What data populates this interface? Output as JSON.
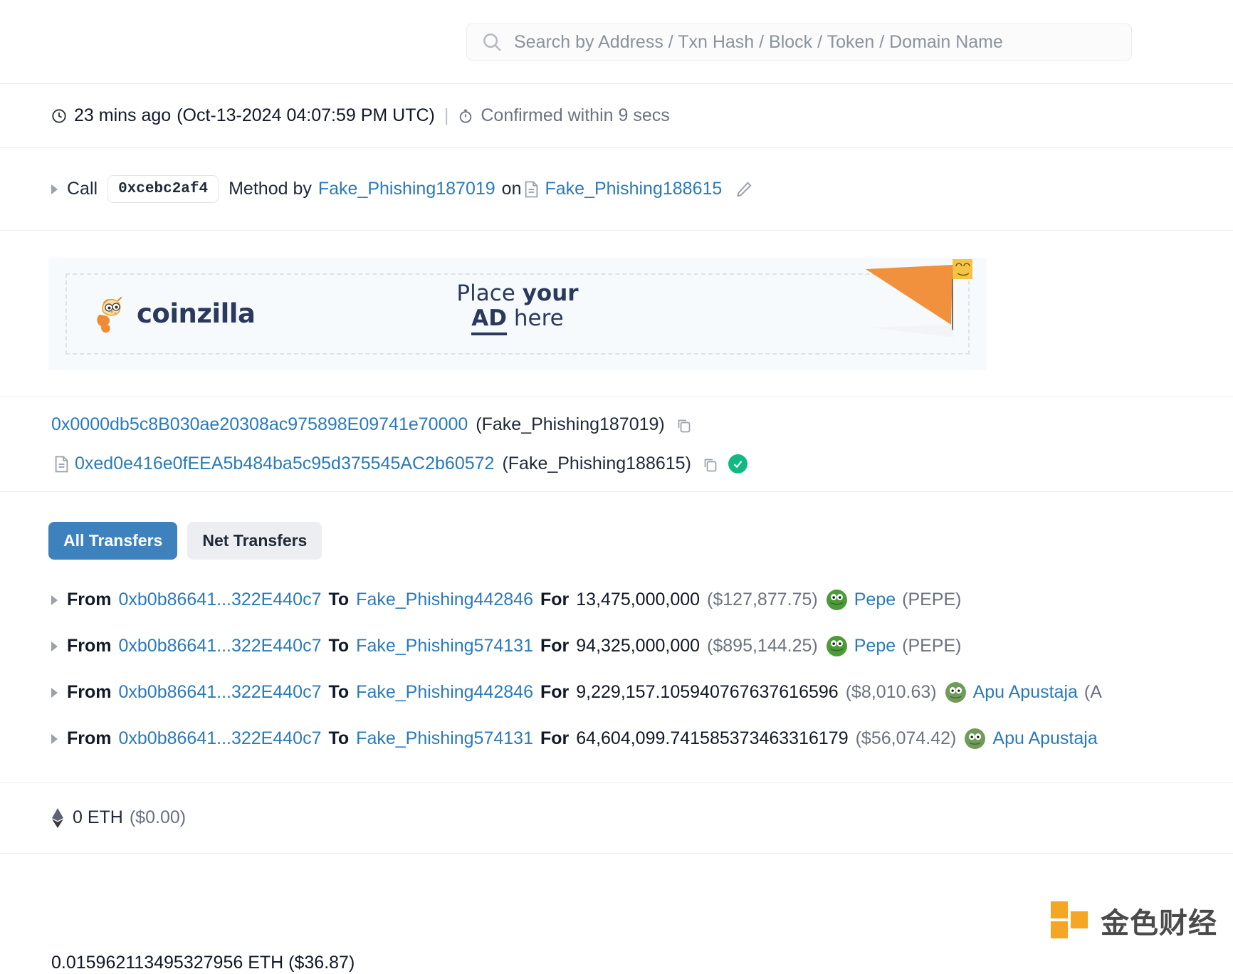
{
  "search": {
    "placeholder": "Search by Address / Txn Hash / Block / Token / Domain Name",
    "icon": "search-icon"
  },
  "timestamp": {
    "relative": "23 mins ago",
    "absolute": "(Oct-13-2024 04:07:59 PM UTC)",
    "separator": "|",
    "confirmation": "Confirmed within 9 secs",
    "clock_icon": "clock-icon",
    "timer_icon": "timer-icon"
  },
  "method": {
    "call_label": "Call",
    "method_id": "0xcebc2af4",
    "by_label": "Method by",
    "caller": "Fake_Phishing187019",
    "on_label": "on",
    "contract": "Fake_Phishing188615",
    "edit_icon": "pencil-icon",
    "contract_icon": "document-icon"
  },
  "ad": {
    "brand": "coinzilla",
    "line1_a": "Place ",
    "line1_b": "your",
    "line2_a": "AD",
    "line2_b": " here"
  },
  "addresses": {
    "from": {
      "hash": "0x0000db5c8B030ae20308ac975898E09741e70000",
      "tag": "(Fake_Phishing187019)",
      "copy_icon": "copy-icon"
    },
    "to": {
      "hash": "0xed0e416e0fEEA5b484ba5c95d375545AC2b60572",
      "tag": "(Fake_Phishing188615)",
      "copy_icon": "copy-icon",
      "verified_icon": "check-circle-icon",
      "contract_icon": "document-icon"
    }
  },
  "transfer_tabs": [
    {
      "label": "All Transfers",
      "active": true
    },
    {
      "label": "Net Transfers",
      "active": false
    }
  ],
  "transfers": {
    "from_label": "From",
    "to_label": "To",
    "for_label": "For",
    "rows": [
      {
        "from": "0xb0b86641...322E440c7",
        "to": "Fake_Phishing442846",
        "amount": "13,475,000,000",
        "usd": "($127,877.75)",
        "token_name": "Pepe",
        "token_symbol": "(PEPE)",
        "token_color": "#4d9a3a"
      },
      {
        "from": "0xb0b86641...322E440c7",
        "to": "Fake_Phishing574131",
        "amount": "94,325,000,000",
        "usd": "($895,144.25)",
        "token_name": "Pepe",
        "token_symbol": "(PEPE)",
        "token_color": "#4d9a3a"
      },
      {
        "from": "0xb0b86641...322E440c7",
        "to": "Fake_Phishing442846",
        "amount": "9,229,157.105940767637616596",
        "usd": "($8,010.63)",
        "token_name": "Apu Apustaja",
        "token_symbol": "(A",
        "token_color": "#6f9c5a"
      },
      {
        "from": "0xb0b86641...322E440c7",
        "to": "Fake_Phishing574131",
        "amount": "64,604,099.741585373463316179",
        "usd": "($56,074.42)",
        "token_name": "Apu Apustaja",
        "token_symbol": "",
        "token_color": "#6f9c5a"
      }
    ]
  },
  "value": {
    "eth_icon": "ethereum-icon",
    "amount": "0 ETH",
    "usd": "($0.00)"
  },
  "fee": {
    "text": "0.015962113495327956 ETH ($36.87)"
  },
  "watermark": {
    "text": "金色财经"
  },
  "colors": {
    "link": "#2a7ab9",
    "tab_active_bg": "#3d82bd",
    "verified_green": "#10b981",
    "ad_navy": "#2b3a5c",
    "watermark_orange": "#f5a623"
  }
}
